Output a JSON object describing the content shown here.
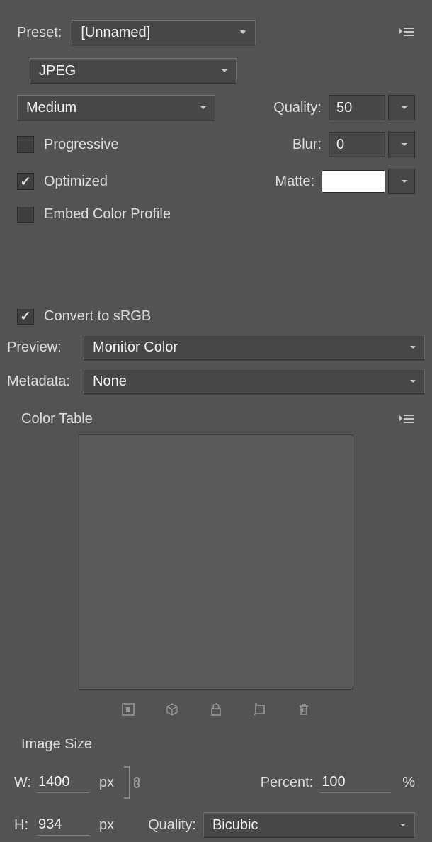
{
  "header": {
    "preset_label": "Preset:",
    "preset_value": "[Unnamed]"
  },
  "format": {
    "type": "JPEG",
    "quality_preset": "Medium",
    "quality_label": "Quality:",
    "quality_value": "50",
    "blur_label": "Blur:",
    "blur_value": "0",
    "matte_label": "Matte:",
    "matte_color": "#FFFFFF",
    "progressive": {
      "label": "Progressive",
      "checked": false
    },
    "optimized": {
      "label": "Optimized",
      "checked": true
    },
    "embed_profile": {
      "label": "Embed Color Profile",
      "checked": false
    }
  },
  "color": {
    "convert_srgb": {
      "label": "Convert to sRGB",
      "checked": true
    },
    "preview_label": "Preview:",
    "preview_value": "Monitor Color",
    "metadata_label": "Metadata:",
    "metadata_value": "None",
    "colortable_label": "Color Table"
  },
  "imagesize": {
    "title": "Image Size",
    "w_label": "W:",
    "w_value": "1400",
    "h_label": "H:",
    "h_value": "934",
    "unit": "px",
    "percent_label": "Percent:",
    "percent_value": "100",
    "percent_unit": "%",
    "quality_label": "Quality:",
    "quality_value": "Bicubic"
  }
}
